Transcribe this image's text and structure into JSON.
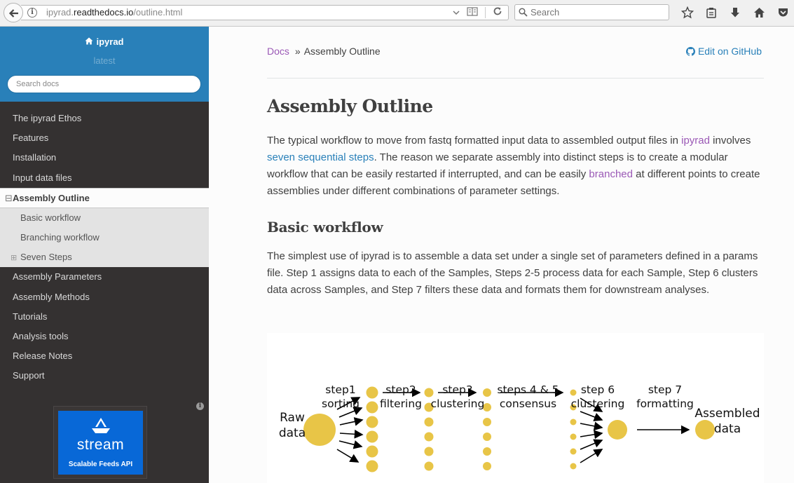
{
  "browser": {
    "url_prefix": "ipyrad.",
    "url_domain": "readthedocs.io",
    "url_path": "/outline.html",
    "search_placeholder": "Search"
  },
  "sidebar": {
    "project": "ipyrad",
    "version": "latest",
    "search_placeholder": "Search docs",
    "items": [
      {
        "label": "The ipyrad Ethos"
      },
      {
        "label": "Features"
      },
      {
        "label": "Installation"
      },
      {
        "label": "Input data files"
      },
      {
        "label": "Assembly Outline",
        "current": true
      },
      {
        "label": "Basic workflow",
        "sub": true
      },
      {
        "label": "Branching workflow",
        "sub": true
      },
      {
        "label": "Seven Steps",
        "sub": true,
        "expandable": true
      },
      {
        "label": "Assembly Parameters"
      },
      {
        "label": "Assembly Methods"
      },
      {
        "label": "Tutorials"
      },
      {
        "label": "Analysis tools"
      },
      {
        "label": "Release Notes"
      },
      {
        "label": "Support"
      }
    ],
    "ad": {
      "title": "stream",
      "subtitle": "Scalable Feeds API"
    }
  },
  "content": {
    "breadcrumb_root": "Docs",
    "breadcrumb_sep": "»",
    "breadcrumb_current": "Assembly Outline",
    "edit_link": "Edit on GitHub",
    "title": "Assembly Outline",
    "p1": {
      "t1": "The typical workflow to move from fastq formatted input data to assembled output files in ",
      "link1": "ipyrad",
      "t2": " involves ",
      "link2": "seven sequential steps",
      "t3": ". The reason we separate assembly into distinct steps is to create a modular workflow that can be easily restarted if interrupted, and can be easily ",
      "link3": "branched",
      "t4": " at different points to create assemblies under different combinations of parameter settings."
    },
    "h2": "Basic workflow",
    "p2": "The simplest use of ipyrad is to assemble a data set under a single set of parameters defined in a params file. Step 1 assigns data to each of the Samples, Steps 2-5 process data for each Sample, Step 6 clusters data across Samples, and Step 7 filters these data and formats them for downstream analyses.",
    "figure": {
      "raw": [
        "Raw",
        "data"
      ],
      "steps": [
        [
          "step1",
          "sorting"
        ],
        [
          "step2",
          "filtering"
        ],
        [
          "step3",
          "clustering"
        ],
        [
          "steps 4 & 5",
          "consensus"
        ],
        [
          "step 6",
          "clustering"
        ],
        [
          "step 7",
          "formatting"
        ]
      ],
      "assembled": [
        "Assembled",
        "data"
      ],
      "dot_color": "#e8c547"
    }
  }
}
